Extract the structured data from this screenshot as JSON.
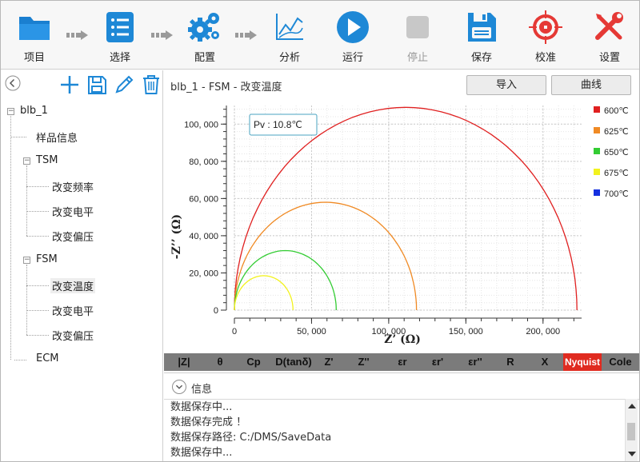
{
  "toolbar": {
    "items": [
      {
        "label": "项目",
        "icon": "folder-icon"
      },
      {
        "label": "选择",
        "icon": "list-icon"
      },
      {
        "label": "配置",
        "icon": "gears-icon"
      },
      {
        "label": "分析",
        "icon": "chart-line-icon"
      },
      {
        "label": "运行",
        "icon": "play-icon"
      },
      {
        "label": "停止",
        "icon": "stop-icon",
        "disabled": true
      },
      {
        "label": "保存",
        "icon": "save-icon"
      },
      {
        "label": "校准",
        "icon": "target-icon"
      },
      {
        "label": "设置",
        "icon": "tools-icon"
      }
    ]
  },
  "tree": {
    "root": "blb_1",
    "sample_info": "样品信息",
    "tsm": "TSM",
    "tsm_children": [
      "改变频率",
      "改变电平",
      "改变偏压"
    ],
    "fsm": "FSM",
    "fsm_children": [
      "改变温度",
      "改变电平",
      "改变偏压"
    ],
    "ecm": "ECM",
    "selected": "改变温度"
  },
  "main": {
    "breadcrumb": "blb_1 - FSM - 改变温度",
    "import_button": "导入",
    "curve_button": "曲线"
  },
  "tabs": [
    "|Z|",
    "θ",
    "Cp",
    "D(tanδ)",
    "Z'",
    "Z''",
    "εr",
    "εr'",
    "εr''",
    "R",
    "X",
    "Nyquist",
    "Cole"
  ],
  "active_tab": "Nyquist",
  "info": {
    "title": "信息",
    "log": [
      "数据保存中...",
      "数据保存完成 ！",
      "数据保存路径: C:/DMS/SaveData",
      "数据保存中..."
    ]
  },
  "colors": {
    "accent_blue": "#1e88d6",
    "active_tab_red": "#e02b20",
    "icon_red": "#e53935"
  },
  "chart_data": {
    "type": "line",
    "title": "",
    "xlabel": "Z’ (Ω)",
    "ylabel": "-Z’’ (Ω)",
    "xlim": [
      0,
      225000
    ],
    "ylim": [
      0,
      110000
    ],
    "xticks": [
      0,
      50000,
      100000,
      150000,
      200000
    ],
    "xtick_labels": [
      "0",
      "50, 000",
      "100, 000",
      "150, 000",
      "200, 000"
    ],
    "yticks": [
      0,
      20000,
      40000,
      60000,
      80000,
      100000
    ],
    "ytick_labels": [
      "0",
      "20, 000",
      "40, 000",
      "60, 000",
      "80, 000",
      "100, 000"
    ],
    "grid": true,
    "legend_position": "right",
    "annotation": "Pv :  10.8℃",
    "series": [
      {
        "name": "600℃",
        "color": "#e02020",
        "R": 222000,
        "peak": 109000
      },
      {
        "name": "625℃",
        "color": "#f08a24",
        "R": 118000,
        "peak": 58000
      },
      {
        "name": "650℃",
        "color": "#33cc33",
        "R": 66000,
        "peak": 32000
      },
      {
        "name": "675℃",
        "color": "#f2f21e",
        "R": 38000,
        "peak": 18500
      },
      {
        "name": "700℃",
        "color": "#1530e0",
        "R": 0,
        "peak": 0
      }
    ]
  }
}
